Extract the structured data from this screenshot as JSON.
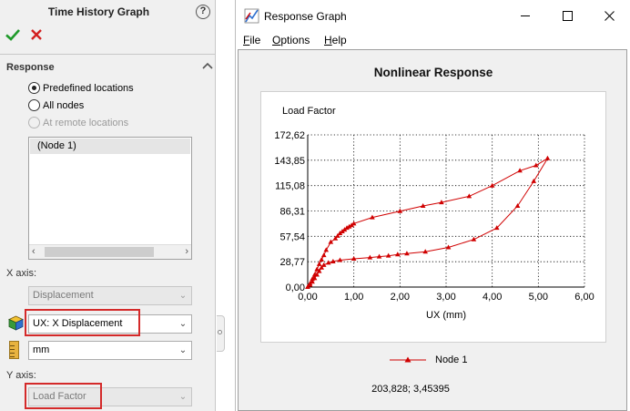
{
  "panel": {
    "title": "Time History Graph",
    "help": "?",
    "response_section": "Response",
    "options": [
      {
        "label": "Predefined locations",
        "selected": true,
        "enabled": true
      },
      {
        "label": "All nodes",
        "selected": false,
        "enabled": true
      },
      {
        "label": "At remote locations",
        "selected": false,
        "enabled": false
      }
    ],
    "locations": [
      "(Node 1)"
    ],
    "x_axis_label": "X axis:",
    "x_axis_quantity": "Displacement",
    "x_axis_component": "UX: X Displacement",
    "x_axis_units": "mm",
    "y_axis_label": "Y axis:",
    "y_axis_quantity": "Load Factor"
  },
  "window": {
    "title": "Response Graph",
    "menu": [
      {
        "label": "File",
        "underline": "F",
        "rest": "ile"
      },
      {
        "label": "Options",
        "underline": "O",
        "rest": "ptions"
      },
      {
        "label": "Help",
        "underline": "H",
        "rest": "elp"
      }
    ],
    "readout": "203,828; 3,45395"
  },
  "colors": {
    "series": "#d00000",
    "highlight": "#d42a2a",
    "ok": "#1f9a2a",
    "cancel": "#d32020"
  },
  "icons": [
    "help-icon",
    "ok-check-icon",
    "cancel-x-icon",
    "collapse-chevron-icon",
    "component-cube-icon",
    "units-ruler-icon",
    "app-icon",
    "minimize-icon",
    "maximize-icon",
    "close-icon"
  ],
  "chart_data": {
    "type": "line",
    "title": "Nonlinear Response",
    "xlabel": "UX (mm)",
    "ylabel": "Load Factor",
    "xlim": [
      0,
      6
    ],
    "ylim": [
      0,
      172.62
    ],
    "x_ticks": [
      "0,00",
      "1,00",
      "2,00",
      "3,00",
      "4,00",
      "5,00",
      "6,00"
    ],
    "y_ticks": [
      "0,00",
      "28,77",
      "57,54",
      "86,31",
      "115,08",
      "143,85",
      "172,62"
    ],
    "grid": true,
    "legend": "bottom",
    "series": [
      {
        "name": "Node 1",
        "color": "#d00000",
        "marker": "triangle",
        "x": [
          0.0,
          0.05,
          0.1,
          0.15,
          0.2,
          0.25,
          0.3,
          0.35,
          0.4,
          0.5,
          0.6,
          0.65,
          0.7,
          0.75,
          0.8,
          0.85,
          0.9,
          0.95,
          1.0,
          1.4,
          2.0,
          2.5,
          2.9,
          3.5,
          4.0,
          4.6,
          4.95,
          5.2,
          4.9,
          4.55,
          4.1,
          3.6,
          3.05,
          2.55,
          2.15,
          1.95,
          1.75,
          1.55,
          1.35,
          1.0,
          0.7,
          0.55,
          0.45,
          0.35,
          0.3,
          0.25,
          0.2,
          0.15,
          0.1,
          0.05,
          0.0
        ],
        "y": [
          0.0,
          4.0,
          9.0,
          14.0,
          20.0,
          26.0,
          31.0,
          36.0,
          42.0,
          51.0,
          55.0,
          58.0,
          61.0,
          63.0,
          65.0,
          67.0,
          68.5,
          70.0,
          72.0,
          79.0,
          86.0,
          92.0,
          96.0,
          103.0,
          115.0,
          132.0,
          138.0,
          146.0,
          120.0,
          92.0,
          67.0,
          54.0,
          45.0,
          40.0,
          38.0,
          37.0,
          35.5,
          34.5,
          33.5,
          32.0,
          30.5,
          29.0,
          27.5,
          25.0,
          22.0,
          18.0,
          14.0,
          10.0,
          6.0,
          2.5,
          0.0
        ]
      }
    ]
  }
}
